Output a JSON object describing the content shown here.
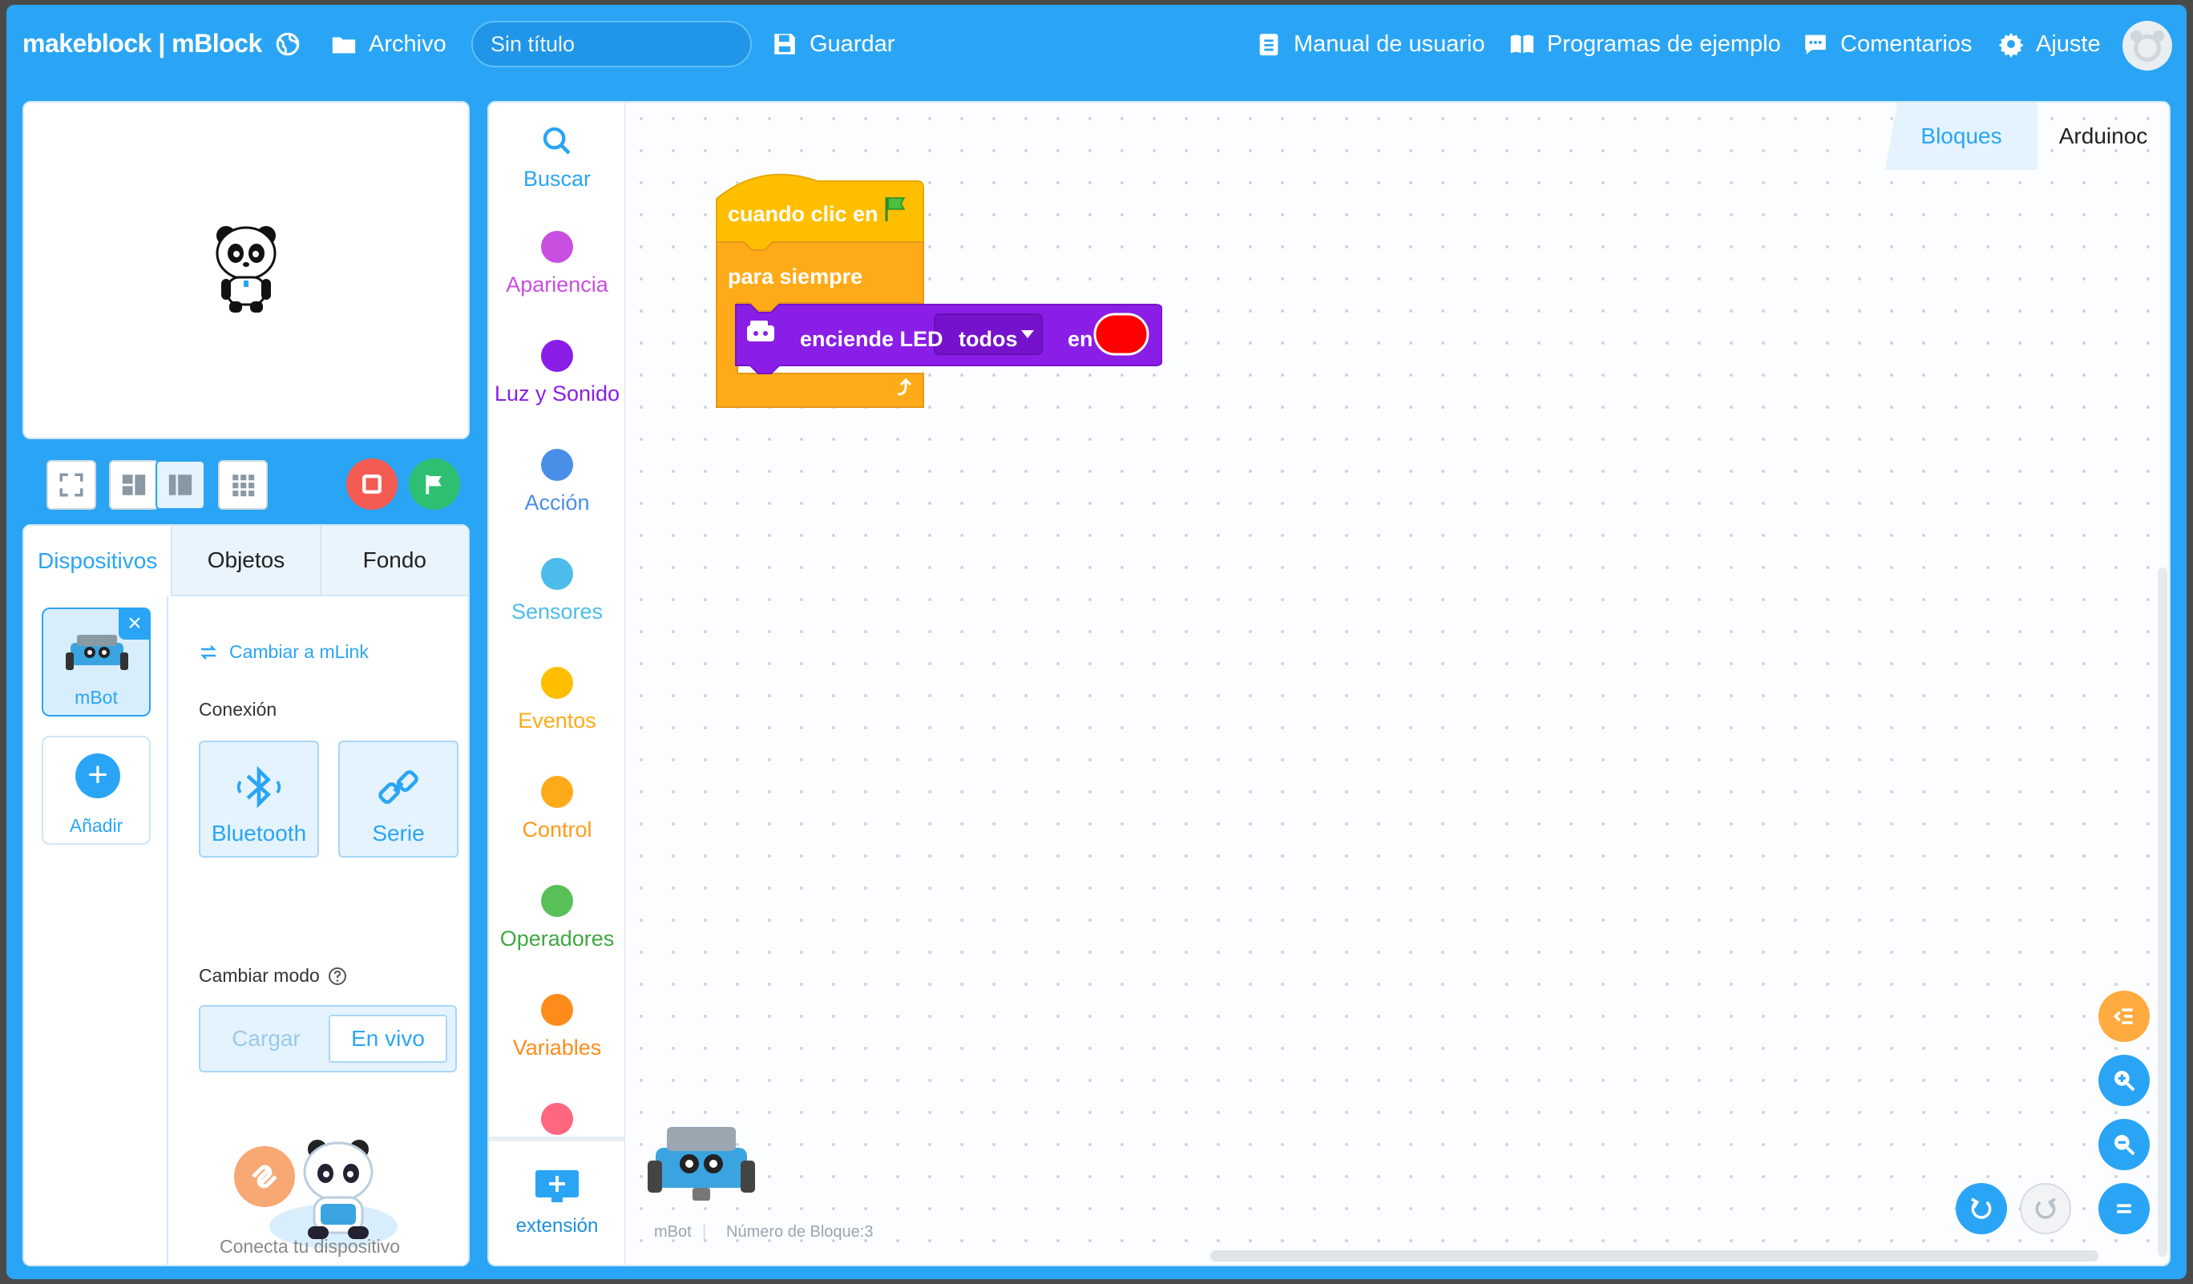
{
  "header": {
    "logo": "makeblock | mBlock",
    "file_label": "Archivo",
    "title_placeholder": "Sin título",
    "save_label": "Guardar",
    "manual_label": "Manual de usuario",
    "examples_label": "Programas de ejemplo",
    "feedback_label": "Comentarios",
    "settings_label": "Ajuste"
  },
  "left_panel": {
    "tabs": [
      "Dispositivos",
      "Objetos",
      "Fondo"
    ],
    "devices": [
      {
        "name": "mBot"
      }
    ],
    "add_label": "Añadir",
    "switch_link": "Cambiar a mLink",
    "connection_label": "Conexión",
    "connection_options": [
      "Bluetooth",
      "Serie"
    ],
    "mode_label": "Cambiar modo",
    "modes": [
      "Cargar",
      "En vivo"
    ],
    "connect_hint": "Conecta tu dispositivo"
  },
  "palette": {
    "categories": [
      {
        "label": "Buscar",
        "color": "#2aa5f5"
      },
      {
        "label": "Apariencia",
        "color": "#c94fe0"
      },
      {
        "label": "Luz y Sonido",
        "color": "#8a1ee6"
      },
      {
        "label": "Acción",
        "color": "#4a8fe7"
      },
      {
        "label": "Sensores",
        "color": "#4cbcea"
      },
      {
        "label": "Eventos",
        "color": "#ffbf00"
      },
      {
        "label": "Control",
        "color": "#ffab19"
      },
      {
        "label": "Operadores",
        "color": "#59c059"
      },
      {
        "label": "Variables",
        "color": "#ff8c1a"
      }
    ],
    "extension_label": "extensión"
  },
  "workspace": {
    "tabs": [
      "Bloques",
      "Arduinoc"
    ],
    "blocks": {
      "hat": "cuando clic en",
      "forever": "para siempre",
      "led_action": "enciende LED",
      "led_dropdown": "todos",
      "led_preposition": "en",
      "led_color": "#ff0000"
    },
    "status_device": "mBot",
    "status_blocks": "Número de Bloque:3"
  }
}
